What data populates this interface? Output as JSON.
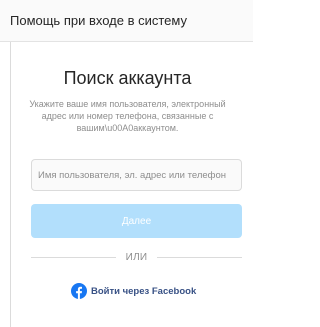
{
  "header": {
    "title": "Помощь при входе в систему"
  },
  "main": {
    "heading": "Поиск аккаунта",
    "description": "Укажите ваше имя пользователя, электронный адрес или номер телефона, связанные с вашим\\u00A0аккаунтом.",
    "search": {
      "placeholder": "Имя пользователя, эл. адрес или телефон",
      "value": ""
    },
    "next_button_label": "Далее",
    "divider_label": "ИЛИ",
    "facebook_login": {
      "label": "Войти через Facebook",
      "icon": "facebook-icon"
    }
  },
  "colors": {
    "accent": "#0095f6",
    "button_disabled": "#b2dffc",
    "facebook_blue": "#1877f2",
    "facebook_text": "#385185"
  }
}
